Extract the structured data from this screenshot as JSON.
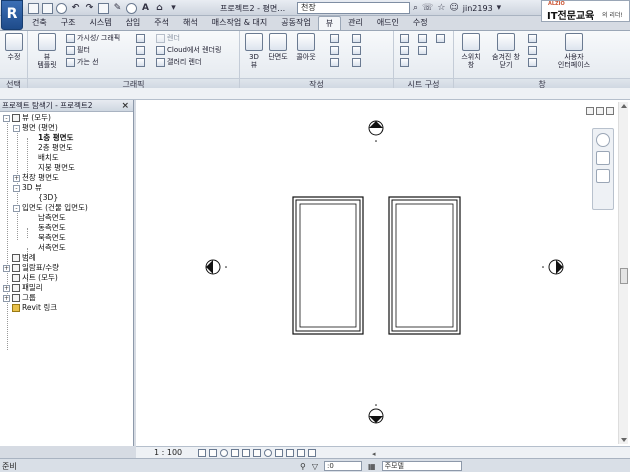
{
  "titlebar": {
    "app_letter": "R",
    "doc_title": "프로젝트2 - 평면…",
    "search_value": "천장",
    "user_name": "jin2193",
    "promo_small": "ALZIO",
    "promo_main": "IT전문교육",
    "promo_sub": "의 리더!"
  },
  "ribbon_tabs": [
    "건축",
    "구조",
    "시스템",
    "삽입",
    "주석",
    "해석",
    "매스작업 & 대지",
    "공동작업",
    "뷰",
    "관리",
    "애드인",
    "수정"
  ],
  "active_tab": "뷰",
  "ribbon": {
    "select_panel_label": "선택",
    "modify_label": "수정",
    "graphics_panel_label": "그래픽",
    "create_panel_label": "작성",
    "sheet_panel_label": "시트 구성",
    "window_panel_label": "창",
    "view_templates": "뷰\n템플릿",
    "visibility_graphics": "가시성/ 그래픽",
    "filters": "필터",
    "thin_lines": "가는 선",
    "render": "렌더",
    "render_cloud": "Cloud에서 렌더링",
    "render_gallery": "갤러리 렌더",
    "view_3d": "3D\n뷰",
    "section": "단면도",
    "callout": "콜아웃",
    "switch_windows": "스위치\n창",
    "close_hidden": "숨겨진 창\n닫기",
    "user_interface": "사용자\n인터페이스"
  },
  "browser": {
    "title": "프로젝트 탐색기 - 프로젝트2",
    "close": "×",
    "tree": [
      {
        "label": "뷰 (모두)",
        "exp": "-"
      },
      {
        "label": "평면 (평면)",
        "exp": "-"
      },
      {
        "label": "1층 평면도",
        "exp": ""
      },
      {
        "label": "2층 평면도",
        "exp": ""
      },
      {
        "label": "배치도",
        "exp": ""
      },
      {
        "label": "지붕 평면도",
        "exp": ""
      },
      {
        "label": "천장 평면도",
        "exp": "+"
      },
      {
        "label": "3D 뷰",
        "exp": "-"
      },
      {
        "label": "{3D}",
        "exp": ""
      },
      {
        "label": "입면도 (건물 입면도)",
        "exp": "-"
      },
      {
        "label": "남측면도",
        "exp": ""
      },
      {
        "label": "동측면도",
        "exp": ""
      },
      {
        "label": "북측면도",
        "exp": ""
      },
      {
        "label": "서측면도",
        "exp": ""
      },
      {
        "label": "범례",
        "exp": ""
      },
      {
        "label": "일람표/수량",
        "exp": "+"
      },
      {
        "label": "시트 (모두)",
        "exp": ""
      },
      {
        "label": "패밀리",
        "exp": "+"
      },
      {
        "label": "그룹",
        "exp": "+"
      },
      {
        "label": "Revit 링크",
        "exp": ""
      }
    ]
  },
  "viewbar": {
    "scale": "1 : 100"
  },
  "statusbar": {
    "left": "준비",
    "filter_value": ":0",
    "model": "주모델"
  },
  "colors": {
    "accent": "#2c5796",
    "ribbon_bg": "#eef1f5",
    "canvas_bg": "#ffffff"
  }
}
